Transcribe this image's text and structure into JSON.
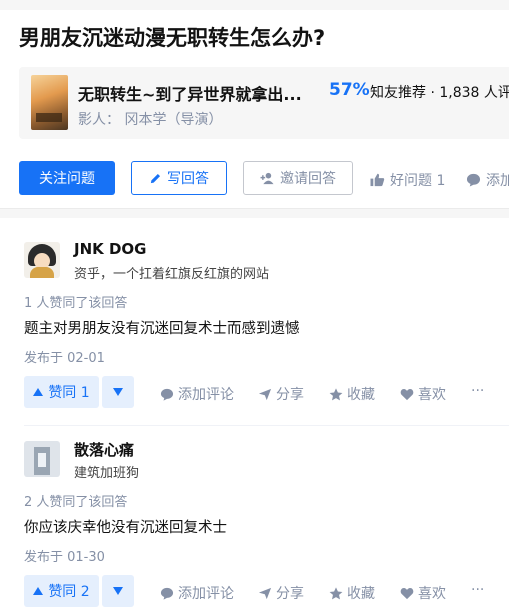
{
  "question": {
    "title": "男朋友沉迷动漫无职转生怎么办?"
  },
  "card": {
    "title": "无职转生~到了异世界就拿出...",
    "percent": "57%",
    "recommend": "知友推荐 · 1,838 人评",
    "people": "影人：  冈本学（导演）"
  },
  "actions": {
    "follow": "关注问题",
    "write": "写回答",
    "invite": "邀请回答",
    "good": "好问题 1",
    "comment": "添加"
  },
  "answers": [
    {
      "author": "JNK DOG",
      "bio": "资乎，一个扛着红旗反红旗的网站",
      "votes": "1 人赞同了该回答",
      "content": "题主对男朋友没有沉迷回复术士而感到遗憾",
      "date": "发布于 02-01",
      "upvote": "赞同 1"
    },
    {
      "author": "散落心痛",
      "bio": "建筑加班狗",
      "votes": "2 人赞同了该回答",
      "content": "你应该庆幸他没有沉迷回复术士",
      "date": "发布于 01-30",
      "upvote": "赞同 2"
    }
  ],
  "tools": {
    "comment": "添加评论",
    "share": "分享",
    "collect": "收藏",
    "like": "喜欢",
    "more": "···"
  },
  "colors": {
    "brand": "#1772f6",
    "muted": "#8590a6",
    "panel": "#f6f6f6"
  }
}
